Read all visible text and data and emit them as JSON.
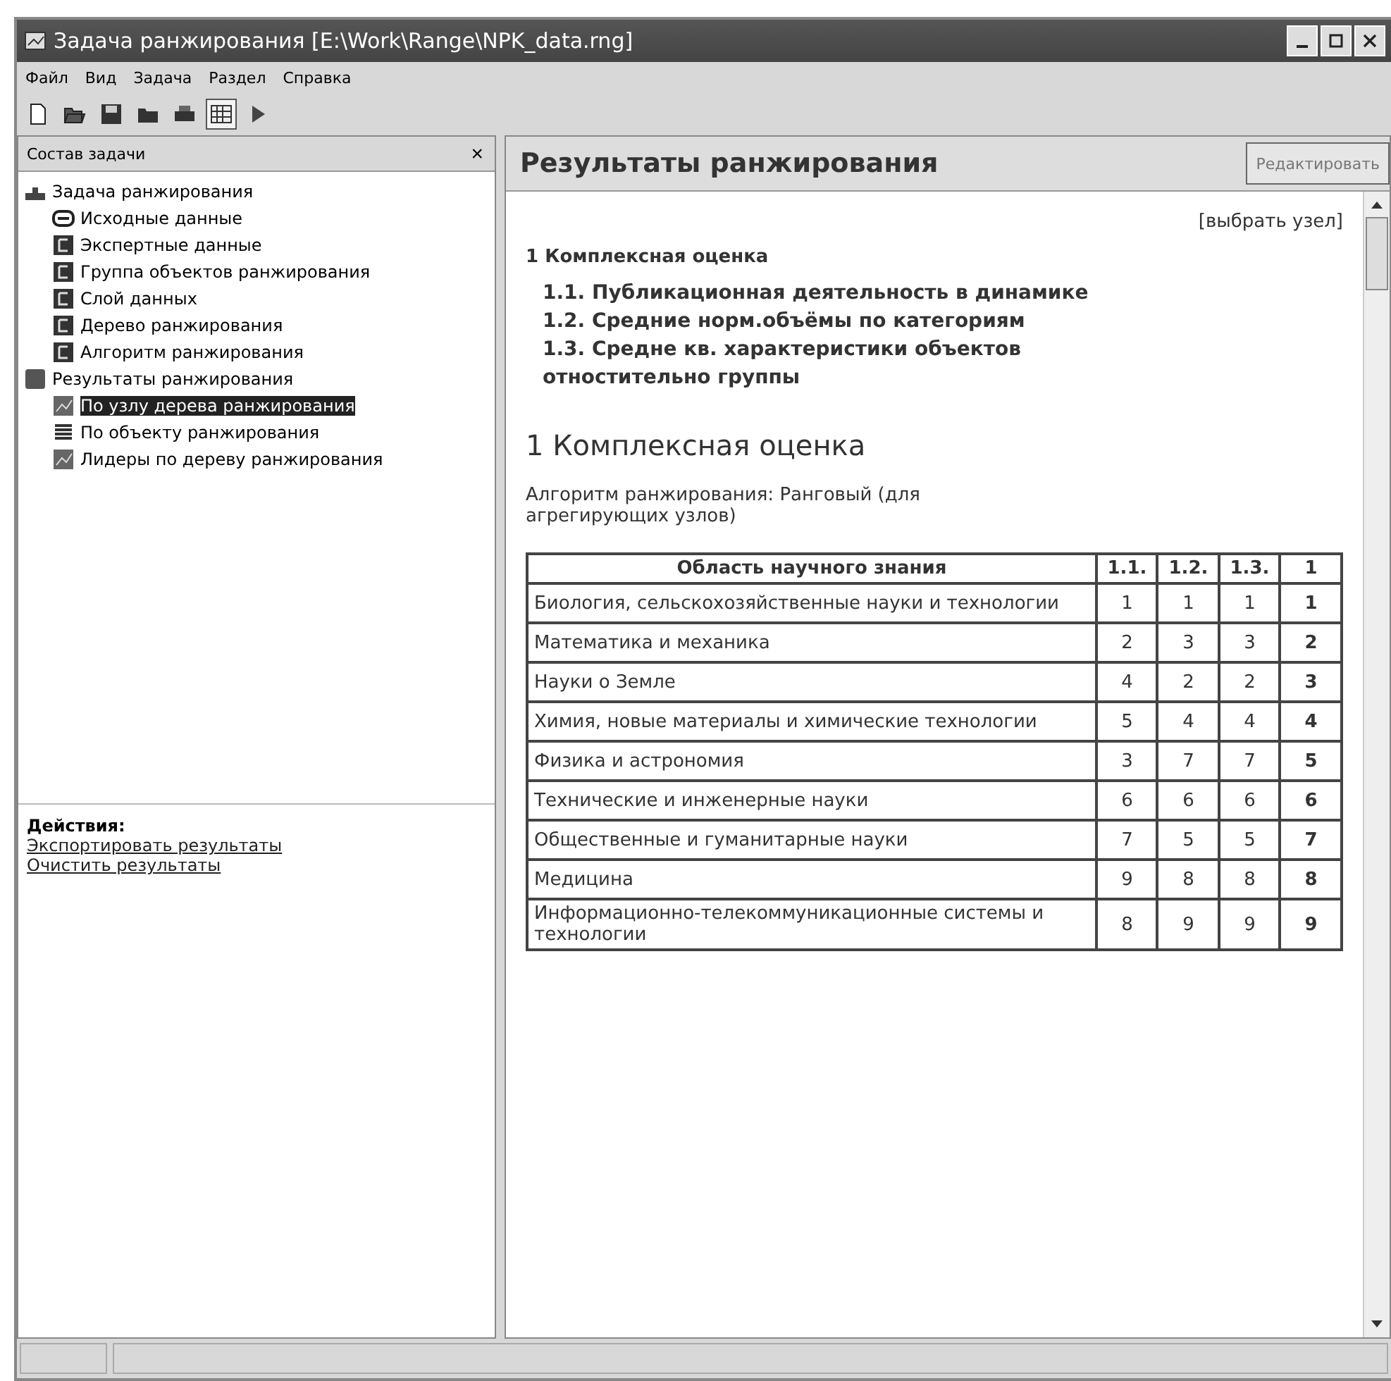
{
  "window": {
    "title": "Задача ранжирования [E:\\Work\\Range\\NPK_data.rng]"
  },
  "menu": [
    {
      "label": "Файл"
    },
    {
      "label": "Вид"
    },
    {
      "label": "Задача"
    },
    {
      "label": "Раздел"
    },
    {
      "label": "Справка"
    }
  ],
  "toolbar": [
    {
      "kind": "new",
      "pressed": false
    },
    {
      "kind": "open",
      "pressed": false
    },
    {
      "kind": "save",
      "pressed": false
    },
    {
      "kind": "folder",
      "pressed": false
    },
    {
      "kind": "print",
      "pressed": false
    },
    {
      "kind": "grid",
      "pressed": true
    },
    {
      "kind": "run",
      "pressed": false
    }
  ],
  "sidebar": {
    "title": "Состав задачи",
    "close": "×",
    "tree": [
      {
        "label": "Задача ранжирования",
        "kind": "task",
        "selected": false,
        "children": [
          {
            "label": "Исходные данные",
            "kind": "source",
            "selected": false
          },
          {
            "label": "Экспертные данные",
            "kind": "doc",
            "selected": false
          },
          {
            "label": "Группа объектов ранжирования",
            "kind": "doc",
            "selected": false
          },
          {
            "label": "Слой данных",
            "kind": "doc",
            "selected": false
          },
          {
            "label": "Дерево ранжирования",
            "kind": "doc",
            "selected": false
          },
          {
            "label": "Алгоритм ранжирования",
            "kind": "doc",
            "selected": false
          }
        ]
      },
      {
        "label": "Результаты ранжирования",
        "kind": "results",
        "selected": false,
        "children": [
          {
            "label": "По узлу дерева ранжирования",
            "kind": "result",
            "selected": true
          },
          {
            "label": "По объекту ранжирования",
            "kind": "list",
            "selected": false
          },
          {
            "label": "Лидеры по дереву ранжирования",
            "kind": "result",
            "selected": false
          }
        ]
      }
    ],
    "actions_title": "Действия:",
    "actions": [
      "Экспортировать результаты",
      "Очистить результаты"
    ]
  },
  "content": {
    "title": "Результаты ранжирования",
    "edit_button": "Редактировать",
    "choose_node": "[выбрать узел]",
    "toc_title": "1 Комплексная оценка",
    "toc": [
      "1.1. Публикационная деятельность в динамике",
      "1.2. Средние норм.объёмы по категориям",
      "1.3. Средне кв. характеристики объектов отностительно группы"
    ],
    "heading": "1 Комплексная оценка",
    "algorithm": "Алгоритм ранжирования: Ранговый (для агрегирующих узлов)",
    "table": {
      "columns": [
        "Область научного знания",
        "1.1.",
        "1.2.",
        "1.3.",
        "1"
      ],
      "rows": [
        [
          "Биология, сельскохозяйственные науки и технологии",
          "1",
          "1",
          "1",
          "1"
        ],
        [
          "Математика и механика",
          "2",
          "3",
          "3",
          "2"
        ],
        [
          "Науки о Земле",
          "4",
          "2",
          "2",
          "3"
        ],
        [
          "Химия, новые материалы и химические технологии",
          "5",
          "4",
          "4",
          "4"
        ],
        [
          "Физика и астрономия",
          "3",
          "7",
          "7",
          "5"
        ],
        [
          "Технические и инженерные науки",
          "6",
          "6",
          "6",
          "6"
        ],
        [
          "Общественные и гуманитарные науки",
          "7",
          "5",
          "5",
          "7"
        ],
        [
          "Медицина",
          "9",
          "8",
          "8",
          "8"
        ],
        [
          "Информационно-телекоммуникационные системы и технологии",
          "8",
          "9",
          "9",
          "9"
        ]
      ]
    }
  }
}
